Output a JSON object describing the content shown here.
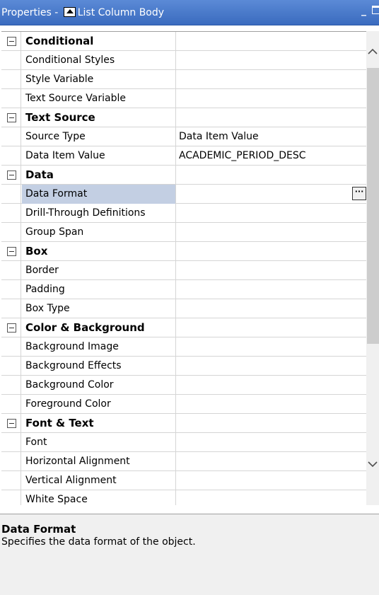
{
  "titlebar": {
    "prefix": "Properties - ",
    "object": "List Column Body",
    "minimize": "_"
  },
  "rows": [
    {
      "kind": "category",
      "name": "Conditional"
    },
    {
      "kind": "prop",
      "name": "Conditional Styles",
      "value": ""
    },
    {
      "kind": "prop",
      "name": "Style Variable",
      "value": ""
    },
    {
      "kind": "prop",
      "name": "Text Source Variable",
      "value": ""
    },
    {
      "kind": "category",
      "name": "Text Source"
    },
    {
      "kind": "prop",
      "name": "Source Type",
      "value": "Data Item Value"
    },
    {
      "kind": "prop",
      "name": "Data Item Value",
      "value": "ACADEMIC_PERIOD_DESC"
    },
    {
      "kind": "category",
      "name": "Data"
    },
    {
      "kind": "prop",
      "name": "Data Format",
      "value": "",
      "selected": true,
      "button": "···"
    },
    {
      "kind": "prop",
      "name": "Drill-Through Definitions",
      "value": ""
    },
    {
      "kind": "prop",
      "name": "Group Span",
      "value": ""
    },
    {
      "kind": "category",
      "name": "Box"
    },
    {
      "kind": "prop",
      "name": "Border",
      "value": ""
    },
    {
      "kind": "prop",
      "name": "Padding",
      "value": ""
    },
    {
      "kind": "prop",
      "name": "Box Type",
      "value": ""
    },
    {
      "kind": "category",
      "name": "Color & Background"
    },
    {
      "kind": "prop",
      "name": "Background Image",
      "value": ""
    },
    {
      "kind": "prop",
      "name": "Background Effects",
      "value": ""
    },
    {
      "kind": "prop",
      "name": "Background Color",
      "value": ""
    },
    {
      "kind": "prop",
      "name": "Foreground Color",
      "value": ""
    },
    {
      "kind": "category",
      "name": "Font & Text"
    },
    {
      "kind": "prop",
      "name": "Font",
      "value": ""
    },
    {
      "kind": "prop",
      "name": "Horizontal Alignment",
      "value": ""
    },
    {
      "kind": "prop",
      "name": "Vertical Alignment",
      "value": ""
    },
    {
      "kind": "prop",
      "name": "White Space",
      "value": ""
    }
  ],
  "description": {
    "title": "Data Format",
    "text": "Specifies the data format of the object."
  }
}
